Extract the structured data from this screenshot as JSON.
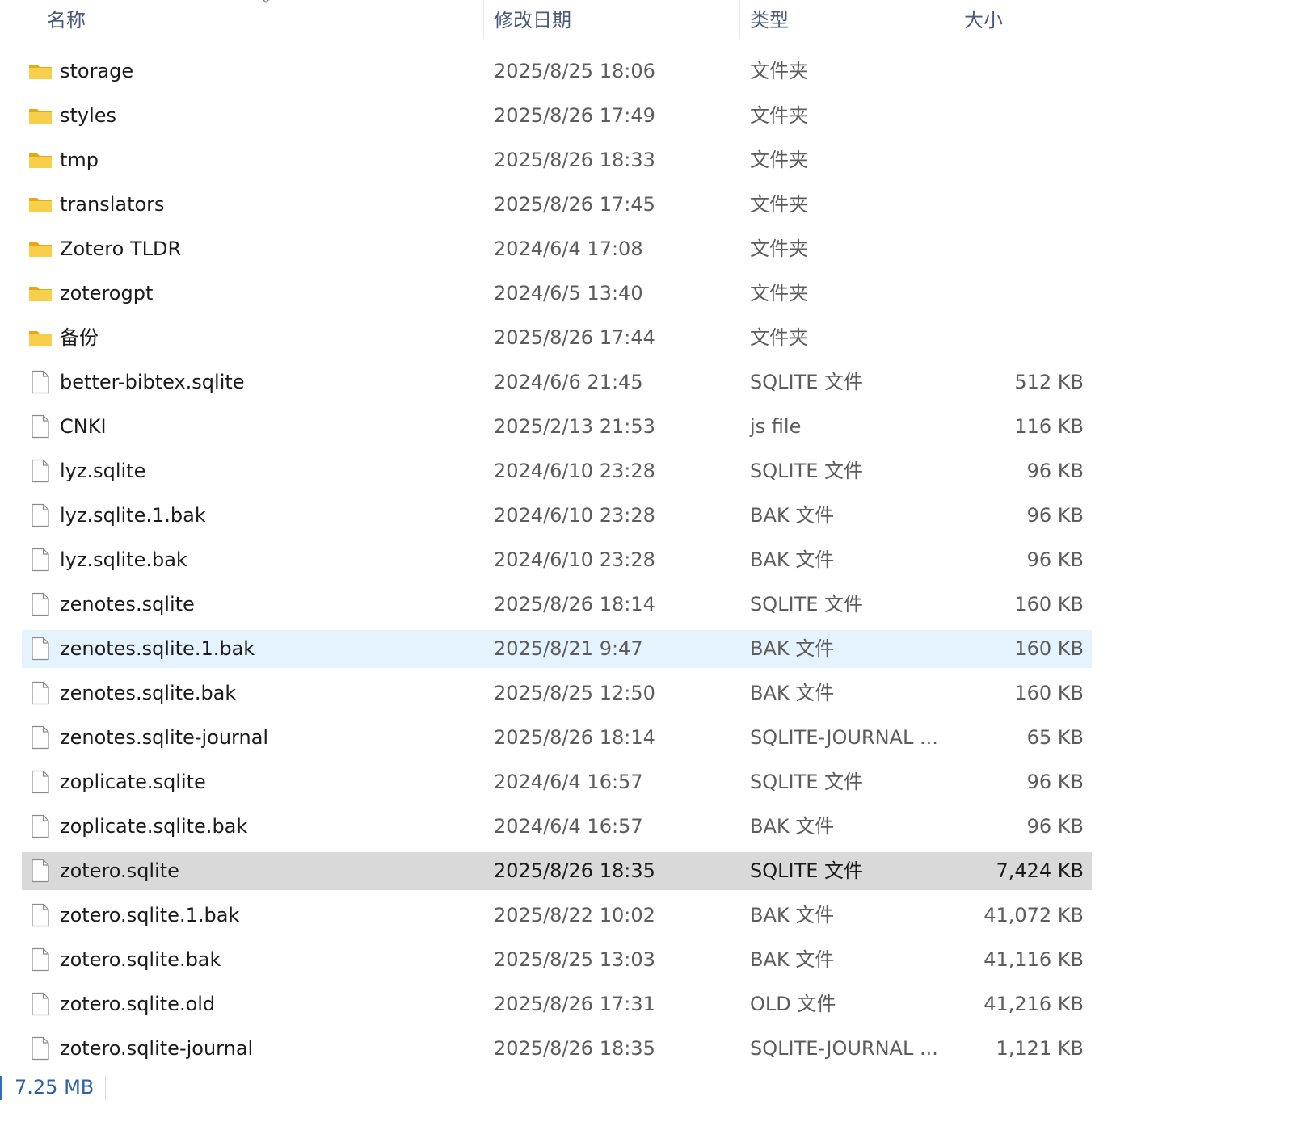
{
  "columns": {
    "name": "名称",
    "date": "修改日期",
    "type": "类型",
    "size": "大小"
  },
  "icons": {
    "folder": "folder-icon",
    "file": "file-icon",
    "sort": "sort-ascending-icon"
  },
  "colors": {
    "folder": "#f4c542",
    "hover_row": "#e5f3ff",
    "selected_row": "#d9d9d9",
    "header_text": "#4a5a78",
    "status_text": "#2f5fa8"
  },
  "files": [
    {
      "name": "storage",
      "date": "2025/8/25 18:06",
      "type": "文件夹",
      "size": "",
      "kind": "folder",
      "state": ""
    },
    {
      "name": "styles",
      "date": "2025/8/26 17:49",
      "type": "文件夹",
      "size": "",
      "kind": "folder",
      "state": ""
    },
    {
      "name": "tmp",
      "date": "2025/8/26 18:33",
      "type": "文件夹",
      "size": "",
      "kind": "folder",
      "state": ""
    },
    {
      "name": "translators",
      "date": "2025/8/26 17:45",
      "type": "文件夹",
      "size": "",
      "kind": "folder",
      "state": ""
    },
    {
      "name": "Zotero TLDR",
      "date": "2024/6/4 17:08",
      "type": "文件夹",
      "size": "",
      "kind": "folder",
      "state": ""
    },
    {
      "name": "zoterogpt",
      "date": "2024/6/5 13:40",
      "type": "文件夹",
      "size": "",
      "kind": "folder",
      "state": ""
    },
    {
      "name": "备份",
      "date": "2025/8/26 17:44",
      "type": "文件夹",
      "size": "",
      "kind": "folder",
      "state": ""
    },
    {
      "name": "better-bibtex.sqlite",
      "date": "2024/6/6 21:45",
      "type": "SQLITE 文件",
      "size": "512 KB",
      "kind": "file",
      "state": ""
    },
    {
      "name": "CNKI",
      "date": "2025/2/13 21:53",
      "type": "js file",
      "size": "116 KB",
      "kind": "file",
      "state": ""
    },
    {
      "name": "lyz.sqlite",
      "date": "2024/6/10 23:28",
      "type": "SQLITE 文件",
      "size": "96 KB",
      "kind": "file",
      "state": ""
    },
    {
      "name": "lyz.sqlite.1.bak",
      "date": "2024/6/10 23:28",
      "type": "BAK 文件",
      "size": "96 KB",
      "kind": "file",
      "state": ""
    },
    {
      "name": "lyz.sqlite.bak",
      "date": "2024/6/10 23:28",
      "type": "BAK 文件",
      "size": "96 KB",
      "kind": "file",
      "state": ""
    },
    {
      "name": "zenotes.sqlite",
      "date": "2025/8/26 18:14",
      "type": "SQLITE 文件",
      "size": "160 KB",
      "kind": "file",
      "state": ""
    },
    {
      "name": "zenotes.sqlite.1.bak",
      "date": "2025/8/21 9:47",
      "type": "BAK 文件",
      "size": "160 KB",
      "kind": "file",
      "state": "hover"
    },
    {
      "name": "zenotes.sqlite.bak",
      "date": "2025/8/25 12:50",
      "type": "BAK 文件",
      "size": "160 KB",
      "kind": "file",
      "state": ""
    },
    {
      "name": "zenotes.sqlite-journal",
      "date": "2025/8/26 18:14",
      "type": "SQLITE-JOURNAL ...",
      "size": "65 KB",
      "kind": "file",
      "state": ""
    },
    {
      "name": "zoplicate.sqlite",
      "date": "2024/6/4 16:57",
      "type": "SQLITE 文件",
      "size": "96 KB",
      "kind": "file",
      "state": ""
    },
    {
      "name": "zoplicate.sqlite.bak",
      "date": "2024/6/4 16:57",
      "type": "BAK 文件",
      "size": "96 KB",
      "kind": "file",
      "state": ""
    },
    {
      "name": "zotero.sqlite",
      "date": "2025/8/26 18:35",
      "type": "SQLITE 文件",
      "size": "7,424 KB",
      "kind": "file",
      "state": "selected"
    },
    {
      "name": "zotero.sqlite.1.bak",
      "date": "2025/8/22 10:02",
      "type": "BAK 文件",
      "size": "41,072 KB",
      "kind": "file",
      "state": ""
    },
    {
      "name": "zotero.sqlite.bak",
      "date": "2025/8/25 13:03",
      "type": "BAK 文件",
      "size": "41,116 KB",
      "kind": "file",
      "state": ""
    },
    {
      "name": "zotero.sqlite.old",
      "date": "2025/8/26 17:31",
      "type": "OLD 文件",
      "size": "41,216 KB",
      "kind": "file",
      "state": ""
    },
    {
      "name": "zotero.sqlite-journal",
      "date": "2025/8/26 18:35",
      "type": "SQLITE-JOURNAL ...",
      "size": "1,121 KB",
      "kind": "file",
      "state": ""
    }
  ],
  "status": {
    "selected_size": "7.25 MB"
  }
}
